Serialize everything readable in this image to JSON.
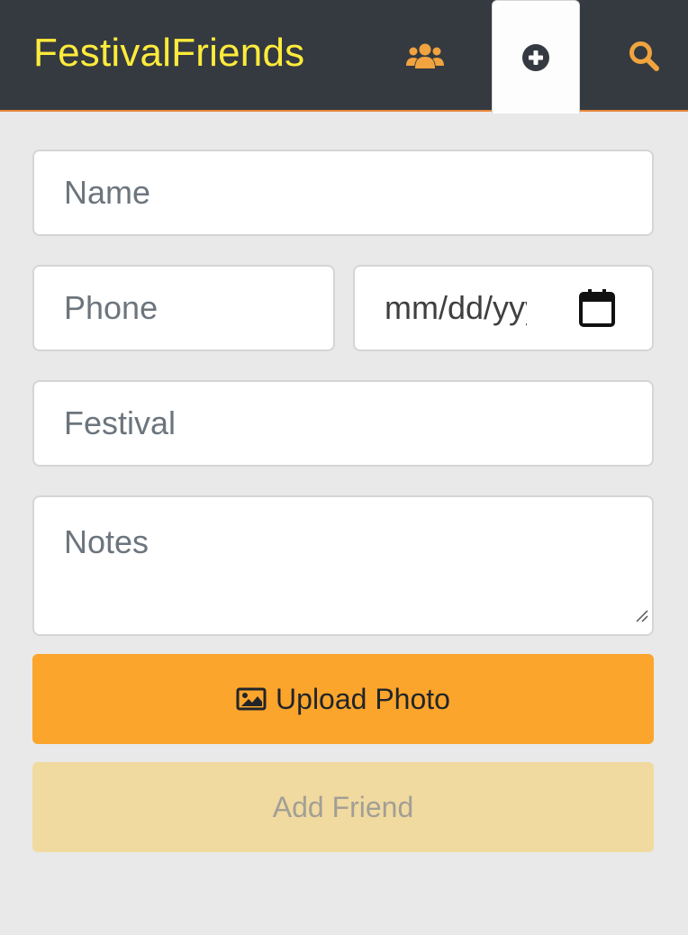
{
  "navbar": {
    "brand": "FestivalFriends",
    "icons": [
      "users-icon",
      "plus-circle-icon",
      "search-icon"
    ],
    "active_tab": "add",
    "colors": {
      "background": "#343a40",
      "brand": "#ffeb3b",
      "accent": "#f0a33e"
    }
  },
  "form": {
    "name_placeholder": "Name",
    "phone_placeholder": "Phone",
    "date_placeholder": "mm/dd/yyyy",
    "festival_placeholder": "Festival",
    "notes_placeholder": "Notes"
  },
  "buttons": {
    "upload_label": "Upload Photo",
    "upload_icon": "image-icon",
    "add_label": "Add Friend"
  }
}
